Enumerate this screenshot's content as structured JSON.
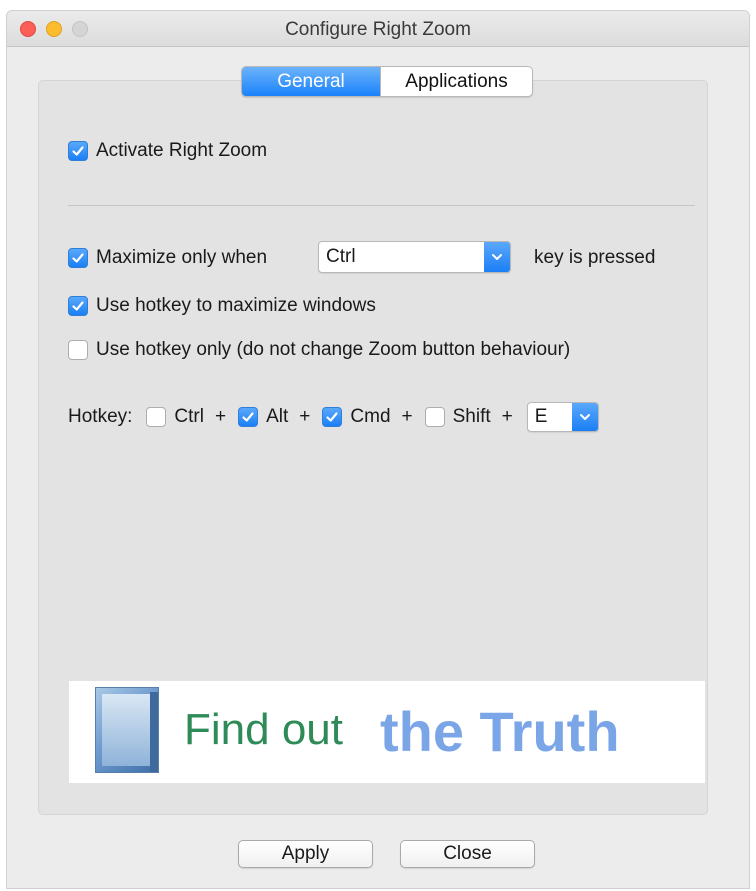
{
  "window": {
    "title": "Configure Right Zoom"
  },
  "tabs": [
    {
      "label": "General",
      "active": true
    },
    {
      "label": "Applications",
      "active": false
    }
  ],
  "general": {
    "activate": {
      "label": "Activate Right Zoom",
      "checked": true
    },
    "maximize_only_when": {
      "label": "Maximize only when",
      "checked": true,
      "key_value": "Ctrl",
      "suffix": "key is pressed"
    },
    "use_hotkey": {
      "label": "Use hotkey to maximize windows",
      "checked": true
    },
    "hotkey_only": {
      "label": "Use hotkey only (do not change Zoom button behaviour)",
      "checked": false
    },
    "hotkey": {
      "label": "Hotkey:",
      "modifiers": [
        {
          "label": "Ctrl",
          "checked": false
        },
        {
          "label": "Alt",
          "checked": true
        },
        {
          "label": "Cmd",
          "checked": true
        },
        {
          "label": "Shift",
          "checked": false
        }
      ],
      "plus": "+",
      "key": "E"
    }
  },
  "ad": {
    "box_icon": "software-box-icon",
    "text_green": "Find out",
    "text_blue": "the Truth",
    "colors": {
      "green": "#2e8b57",
      "blue": "#7aa6e8"
    }
  },
  "buttons": {
    "apply": "Apply",
    "close": "Close"
  },
  "colors": {
    "accent": "#1b7ff5",
    "close": "#fc5f57",
    "minimize": "#fdbc2e",
    "zoom_disabled": "#d5d5d5"
  }
}
